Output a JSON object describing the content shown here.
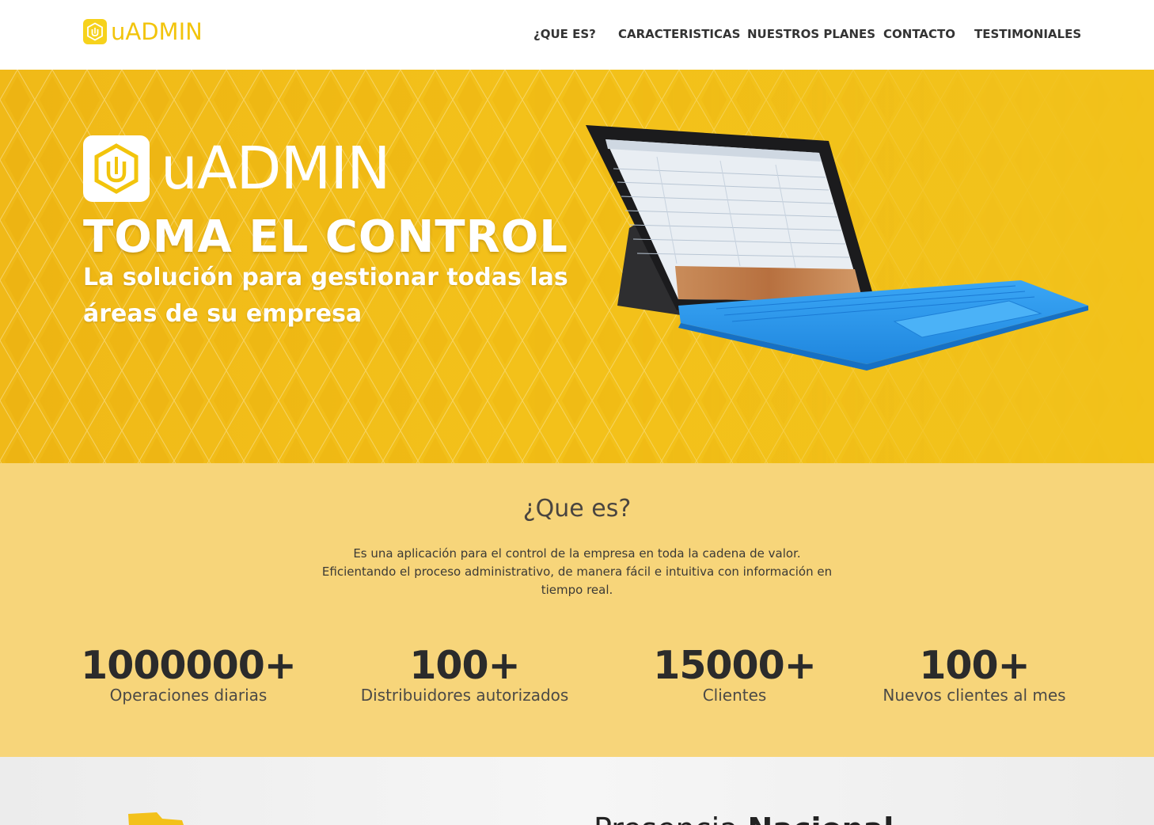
{
  "header": {
    "logo_text": "uADMIN",
    "nav": [
      {
        "label": "¿QUE ES?"
      },
      {
        "label": "CARACTERISTICAS"
      },
      {
        "label": "NUESTROS PLANES"
      },
      {
        "label": "CONTACTO"
      },
      {
        "label": "TESTIMONIALES"
      }
    ]
  },
  "hero": {
    "brand_text": "uADMIN",
    "title": "TOMA EL CONTROL",
    "subtitle": "La solución para gestionar todas las áreas de su empresa",
    "device_icon": "tablet-laptop-image"
  },
  "about": {
    "title": "¿Que es?",
    "description": "Es una aplicación para el control de la empresa en toda la cadena de valor. Eficientando el proceso administrativo, de manera fácil e intuitiva con información en tiempo real.",
    "stats": [
      {
        "number": "1000000+",
        "label": "Operaciones diarias"
      },
      {
        "number": "100+",
        "label": "Distribuidores autorizados"
      },
      {
        "number": "15000+",
        "label": "Clientes"
      },
      {
        "number": "100+",
        "label": "Nuevos clientes al mes"
      }
    ]
  },
  "next_section": {
    "heading_normal": "Presencia ",
    "heading_bold": "Nacional"
  },
  "colors": {
    "brand_yellow": "#f3c11a",
    "logo_yellow": "#f2c40c",
    "about_bg": "#f7d57a",
    "keyboard_blue": "#2a9bf0"
  }
}
